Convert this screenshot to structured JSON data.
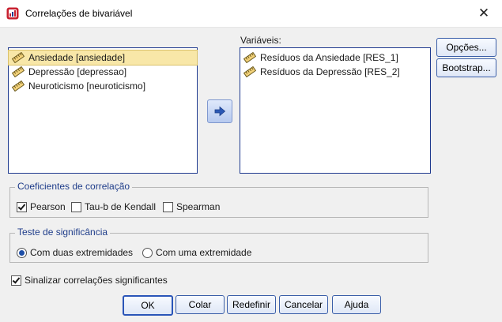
{
  "window": {
    "title": "Correlações de bivariável",
    "close_glyph": "✕"
  },
  "source_list": {
    "items": [
      {
        "label": "Ansiedade [ansiedade]",
        "icon": "ruler-icon",
        "selected": true
      },
      {
        "label": "Depressão [depressao]",
        "icon": "ruler-icon",
        "selected": false
      },
      {
        "label": "Neuroticismo [neuroticismo]",
        "icon": "ruler-icon",
        "selected": false
      }
    ]
  },
  "move_button": {
    "icon": "arrow-right-icon"
  },
  "variables": {
    "label": "Variáveis:",
    "items": [
      {
        "label": "Resíduos da Ansiedade [RES_1]",
        "icon": "ruler-icon"
      },
      {
        "label": "Resíduos da Depressão [RES_2]",
        "icon": "ruler-icon"
      }
    ]
  },
  "side_buttons": {
    "options": "Opções...",
    "bootstrap": "Bootstrap..."
  },
  "coefficients": {
    "title": "Coeficientes de correlação",
    "pearson": {
      "label": "Pearson",
      "checked": true
    },
    "kendall": {
      "label": "Tau-b de Kendall",
      "checked": false
    },
    "spearman": {
      "label": "Spearman",
      "checked": false
    }
  },
  "significance": {
    "title": "Teste de significância",
    "two_tailed": {
      "label": "Com duas extremidades",
      "checked": true
    },
    "one_tailed": {
      "label": "Com uma extremidade",
      "checked": false
    }
  },
  "flag": {
    "label": "Sinalizar correlações significantes",
    "checked": true
  },
  "buttons": {
    "ok": "OK",
    "paste": "Colar",
    "reset": "Redefinir",
    "cancel": "Cancelar",
    "help": "Ajuda"
  },
  "colors": {
    "accent": "#1f3a8f",
    "selection": "#f8e7a8",
    "group_title": "#1f3d8a"
  }
}
